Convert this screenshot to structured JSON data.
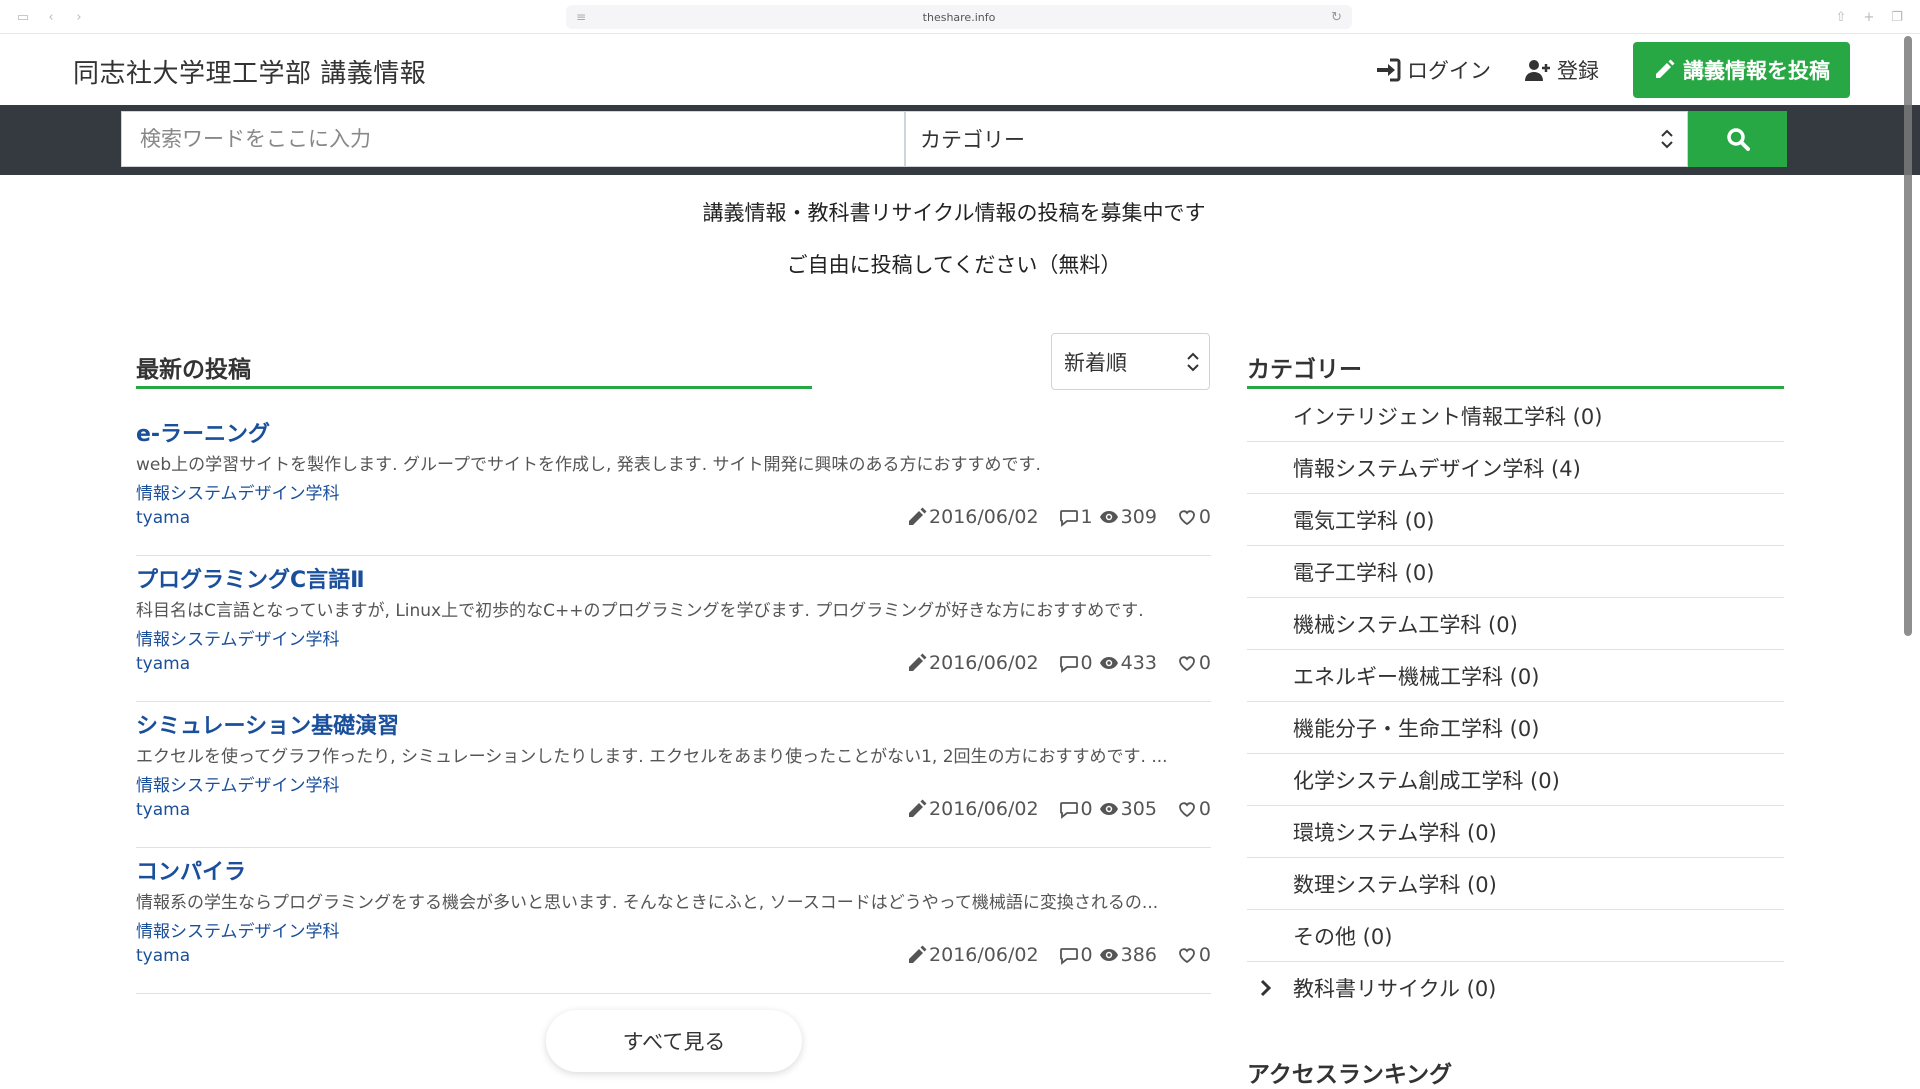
{
  "browser": {
    "url": "theshare.info"
  },
  "header": {
    "site_title": "同志社大学理工学部 講義情報",
    "login_label": "ログイン",
    "register_label": "登録",
    "post_label": "講義情報を投稿"
  },
  "search": {
    "placeholder": "検索ワードをここに入力",
    "category_value": "カテゴリー"
  },
  "announce": {
    "line1": "講義情報・教科書リサイクル情報の投稿を募集中です",
    "line2": "ご自由に投稿してください（無料）"
  },
  "main": {
    "heading": "最新の投稿",
    "sort_value": "新着順",
    "posts": [
      {
        "title": "e-ラーニング",
        "desc": "web上の学習サイトを製作します. グループでサイトを作成し, 発表します. サイト開発に興味のある方におすすめです.",
        "dept": "情報システムデザイン学科",
        "author": "tyama",
        "date": "2016/06/02",
        "comments": "1",
        "views": "309",
        "likes": "0"
      },
      {
        "title": "プログラミングC言語Ⅱ",
        "desc": "科目名はC言語となっていますが, Linux上で初歩的なC++のプログラミングを学びます. プログラミングが好きな方におすすめです.",
        "dept": "情報システムデザイン学科",
        "author": "tyama",
        "date": "2016/06/02",
        "comments": "0",
        "views": "433",
        "likes": "0"
      },
      {
        "title": "シミュレーション基礎演習",
        "desc": "エクセルを使ってグラフ作ったり, シミュレーションしたりします. エクセルをあまり使ったことがない1, 2回生の方におすすめです. ...",
        "dept": "情報システムデザイン学科",
        "author": "tyama",
        "date": "2016/06/02",
        "comments": "0",
        "views": "305",
        "likes": "0"
      },
      {
        "title": "コンパイラ",
        "desc": "情報系の学生ならプログラミングをする機会が多いと思います. そんなときにふと, ソースコードはどうやって機械語に変換されるの...",
        "dept": "情報システムデザイン学科",
        "author": "tyama",
        "date": "2016/06/02",
        "comments": "0",
        "views": "386",
        "likes": "0"
      }
    ],
    "see_all_label": "すべて見る"
  },
  "sidebar": {
    "heading": "カテゴリー",
    "items": [
      {
        "label": "インテリジェント情報工学科 (0)"
      },
      {
        "label": "情報システムデザイン学科 (4)"
      },
      {
        "label": "電気工学科 (0)"
      },
      {
        "label": "電子工学科 (0)"
      },
      {
        "label": "機械システム工学科 (0)"
      },
      {
        "label": "エネルギー機械工学科 (0)"
      },
      {
        "label": "機能分子・生命工学科 (0)"
      },
      {
        "label": "化学システム創成工学科 (0)"
      },
      {
        "label": "環境システム学科 (0)"
      },
      {
        "label": "数理システム学科 (0)"
      },
      {
        "label": "その他 (0)"
      },
      {
        "label": "教科書リサイクル (0)"
      }
    ],
    "ranking_heading": "アクセスランキング"
  },
  "colors": {
    "accent": "#28a745",
    "link": "#1a4f9c",
    "bar": "#343a40"
  },
  "icons": [
    "sign-in-icon",
    "user-plus-icon",
    "pencil-icon",
    "search-icon",
    "comment-icon",
    "eye-icon",
    "heart-icon",
    "chevron-right-icon",
    "select-arrows-icon"
  ]
}
